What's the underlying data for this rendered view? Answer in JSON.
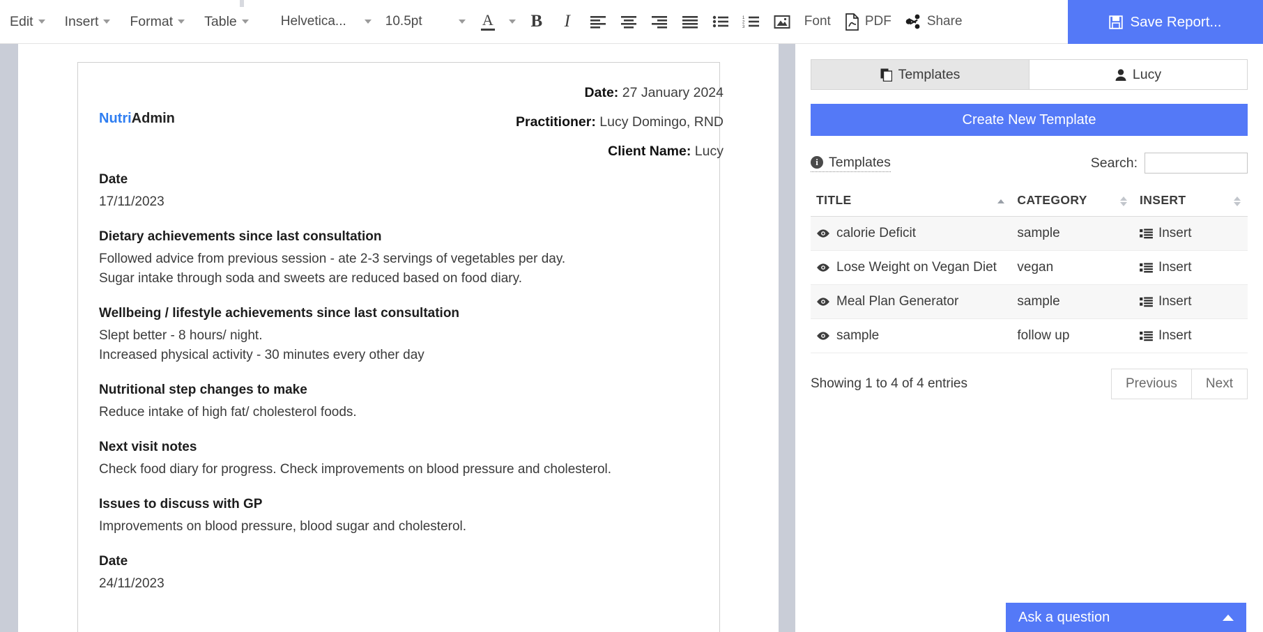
{
  "toolbar": {
    "menus": [
      {
        "label": "Edit",
        "name": "menu-edit"
      },
      {
        "label": "Insert",
        "name": "menu-insert"
      },
      {
        "label": "Format",
        "name": "menu-format"
      },
      {
        "label": "Table",
        "name": "menu-table"
      }
    ],
    "font_family": "Helvetica...",
    "font_size": "10.5pt",
    "text_color_icon": "A",
    "bold_icon": "B",
    "italic_icon": "I",
    "font_label": "Font",
    "pdf_label": "PDF",
    "share_label": "Share",
    "save_report_label": "Save Report...",
    "accent_color": "#5479f7"
  },
  "document": {
    "logo_primary": "Nutri",
    "logo_secondary": "Admin",
    "meta": [
      {
        "label": "Date:",
        "value": "27 January 2024"
      },
      {
        "label": "Practitioner:",
        "value": "Lucy Domingo, RND"
      },
      {
        "label": "Client Name:",
        "value": "Lucy"
      }
    ],
    "sections": [
      {
        "heading": "Date",
        "lines": [
          "17/11/2023"
        ]
      },
      {
        "heading": "Dietary achievements since last consultation",
        "lines": [
          "Followed advice from previous session - ate 2-3 servings of vegetables per day.",
          "Sugar intake through soda and sweets are reduced based on food diary."
        ]
      },
      {
        "heading": "Wellbeing / lifestyle achievements since last consultation",
        "lines": [
          "Slept better - 8 hours/ night.",
          "Increased physical activity - 30 minutes every other day"
        ]
      },
      {
        "heading": "Nutritional step changes to make",
        "lines": [
          "Reduce intake of high fat/ cholesterol foods."
        ]
      },
      {
        "heading": "Next visit notes",
        "lines": [
          "Check food diary for progress. Check improvements on blood pressure and cholesterol."
        ]
      },
      {
        "heading": "Issues to discuss with GP",
        "lines": [
          "Improvements on blood pressure, blood sugar and cholesterol."
        ]
      },
      {
        "heading": "Date",
        "lines": [
          "24/11/2023"
        ]
      }
    ]
  },
  "panel": {
    "tabs": [
      {
        "label": "Templates",
        "icon": "copy-icon",
        "active": true
      },
      {
        "label": "Lucy",
        "icon": "user-icon",
        "active": false
      }
    ],
    "create_button": "Create New Template",
    "templates_link": "Templates",
    "search_label": "Search:",
    "search_value": "",
    "search_placeholder": "",
    "table": {
      "columns": [
        {
          "label": "TITLE",
          "sort": "asc"
        },
        {
          "label": "CATEGORY",
          "sort": "none"
        },
        {
          "label": "INSERT",
          "sort": "none"
        }
      ],
      "rows": [
        {
          "title": "calorie Deficit",
          "category": "sample",
          "insert": "Insert"
        },
        {
          "title": "Lose Weight on Vegan Diet",
          "category": "vegan",
          "insert": "Insert"
        },
        {
          "title": "Meal Plan Generator",
          "category": "sample",
          "insert": "Insert"
        },
        {
          "title": "sample",
          "category": "follow up",
          "insert": "Insert"
        }
      ]
    },
    "entries_text": "Showing 1 to 4 of 4 entries",
    "previous_label": "Previous",
    "next_label": "Next"
  },
  "ask": {
    "label": "Ask a question"
  }
}
